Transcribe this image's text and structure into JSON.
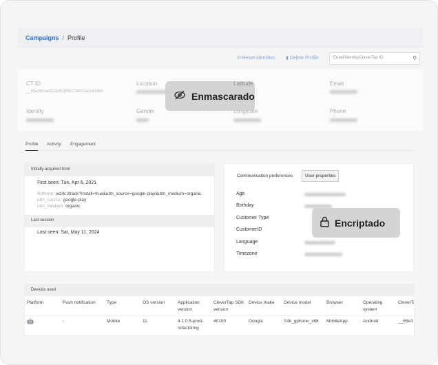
{
  "breadcrumb": {
    "parent": "Campaigns",
    "separator": "/",
    "current": "Profile"
  },
  "toolbar": {
    "reset": "Reset identities",
    "delete": "Delete Profile",
    "search_placeholder": "Email/Identity/CleverTap ID"
  },
  "profile": {
    "ct_id_label": "CT ID",
    "ct_id": "__65e390ae812b453f9b274b07ac440486",
    "location": "Location",
    "latitude": "Latitude",
    "email": "Email",
    "identity": "Identity",
    "gender": "Gender",
    "longitude": "Longitude",
    "phone": "Phone"
  },
  "masked_label": "Enmascarado",
  "encrypted_label": "Encriptado",
  "tabs": [
    "Profile",
    "Activity",
    "Engagement"
  ],
  "acquisition": {
    "header": "Initially acquired from",
    "first_seen": "First seen: Tue, Apr 6, 2021",
    "referrer_key": "Referrer:",
    "referrer": "wzrk://track?install=true&utm_source=google-play&utm_medium=organic",
    "utm_source_key": "utm_source:",
    "utm_source": "google-play",
    "utm_medium_key": "utm_medium:",
    "utm_medium": "organic",
    "last_header": "Last session",
    "last_seen": "Last seen: Sat, May 11, 2024"
  },
  "props": {
    "tabs": [
      "Communication preferences",
      "User properties"
    ],
    "labels": [
      "Age",
      "Birthday",
      "Customer Type",
      "CustomerID",
      "Language",
      "Timezone"
    ]
  },
  "devices": {
    "header": "Devices used",
    "columns": [
      "Platform",
      "Push notification",
      "Type",
      "OS version",
      "Application version",
      "CleverTap SDK version",
      "Device make",
      "Device model",
      "Browser",
      "Operating system",
      "CleverTap"
    ],
    "row": [
      "",
      "-",
      "Mobile",
      "11",
      "4.1.0.5-prod-refactoring",
      "40100",
      "Google",
      "Sdk_gphone_x86",
      "MobileApp",
      "Android",
      "__65e3"
    ]
  }
}
